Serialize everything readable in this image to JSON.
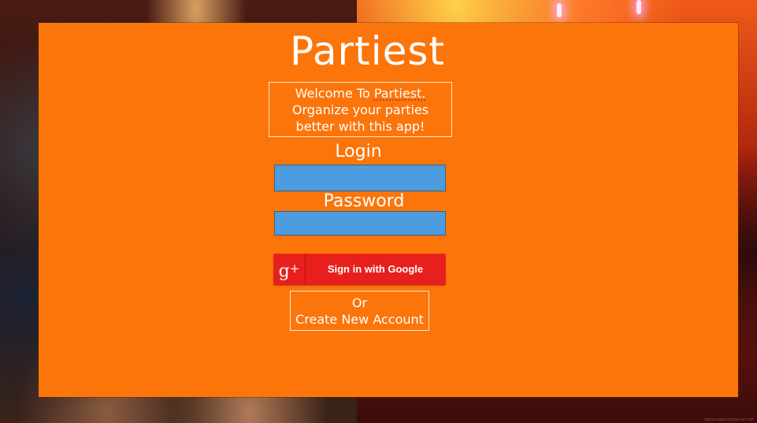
{
  "app": {
    "title": "Partiest"
  },
  "welcome": {
    "line1_prefix": "Welcome To ",
    "line1_brand": "Partiest.",
    "line2": "Organize your parties",
    "line3": "better with this app!"
  },
  "login_form": {
    "login_label": "Login",
    "login_value": "",
    "password_label": "Password",
    "password_value": ""
  },
  "google_signin": {
    "icon_glyph": "g",
    "icon_plus": "+",
    "label": "Sign in with Google",
    "color": "#e8201d"
  },
  "create_account": {
    "line1": "Or",
    "line2": "Create New Account"
  },
  "theme": {
    "panel_color": "#fc750b",
    "input_color": "#4d9ce0"
  },
  "watermark": "fabulouspartyplanner.net"
}
